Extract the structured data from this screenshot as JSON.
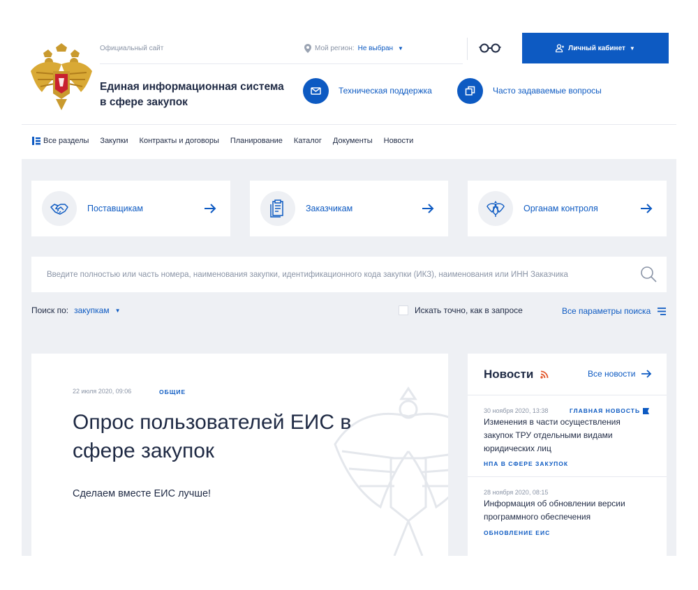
{
  "header": {
    "official_label": "Официальный сайт",
    "region_label": "Мой регион:",
    "region_value": "Не выбран",
    "cabinet_label": "Личный кабинет",
    "site_title_line1": "Единая информационная система",
    "site_title_line2": "в сфере закупок",
    "support_label": "Техническая поддержка",
    "faq_label": "Часто задаваемые вопросы"
  },
  "nav": {
    "all_sections": "Все разделы",
    "items": [
      "Закупки",
      "Контракты и договоры",
      "Планирование",
      "Каталог",
      "Документы",
      "Новости"
    ]
  },
  "cards": [
    {
      "label": "Поставщикам",
      "icon": "handshake-icon"
    },
    {
      "label": "Заказчикам",
      "icon": "document-icon"
    },
    {
      "label": "Органам контроля",
      "icon": "emblem-icon"
    }
  ],
  "search": {
    "placeholder": "Введите полностью или часть номера, наименования закупки, идентификационного кода закупки (ИКЗ), наименования или ИНН Заказчика",
    "search_by_label": "Поиск по:",
    "search_by_value": "закупкам",
    "exact_label": "Искать точно, как в запросе",
    "all_params_label": "Все параметры поиска"
  },
  "feature": {
    "date": "22 июля 2020, 09:06",
    "category": "ОБЩИЕ",
    "title": "Опрос пользователей ЕИС в сфере закупок",
    "subtitle": "Сделаем вместе ЕИС лучше!"
  },
  "news": {
    "title": "Новости",
    "all_label": "Все новости",
    "items": [
      {
        "date": "30 ноября 2020, 13:38",
        "tag": "ГЛАВНАЯ НОВОСТЬ",
        "text": "Изменения в части осуществления закупок ТРУ отдельными видами юридических лиц",
        "category": "НПА В СФЕРЕ ЗАКУПОК"
      },
      {
        "date": "28 ноября 2020, 08:15",
        "tag": "",
        "text": "Информация об обновлении версии программного обеспечения",
        "category": "ОБНОВЛЕНИЕ ЕИС"
      }
    ]
  },
  "colors": {
    "accent": "#0d5ac2",
    "text": "#1f2a44",
    "muted": "#8a94a6",
    "background_gray": "#eef0f4",
    "rss": "#e2562a"
  }
}
